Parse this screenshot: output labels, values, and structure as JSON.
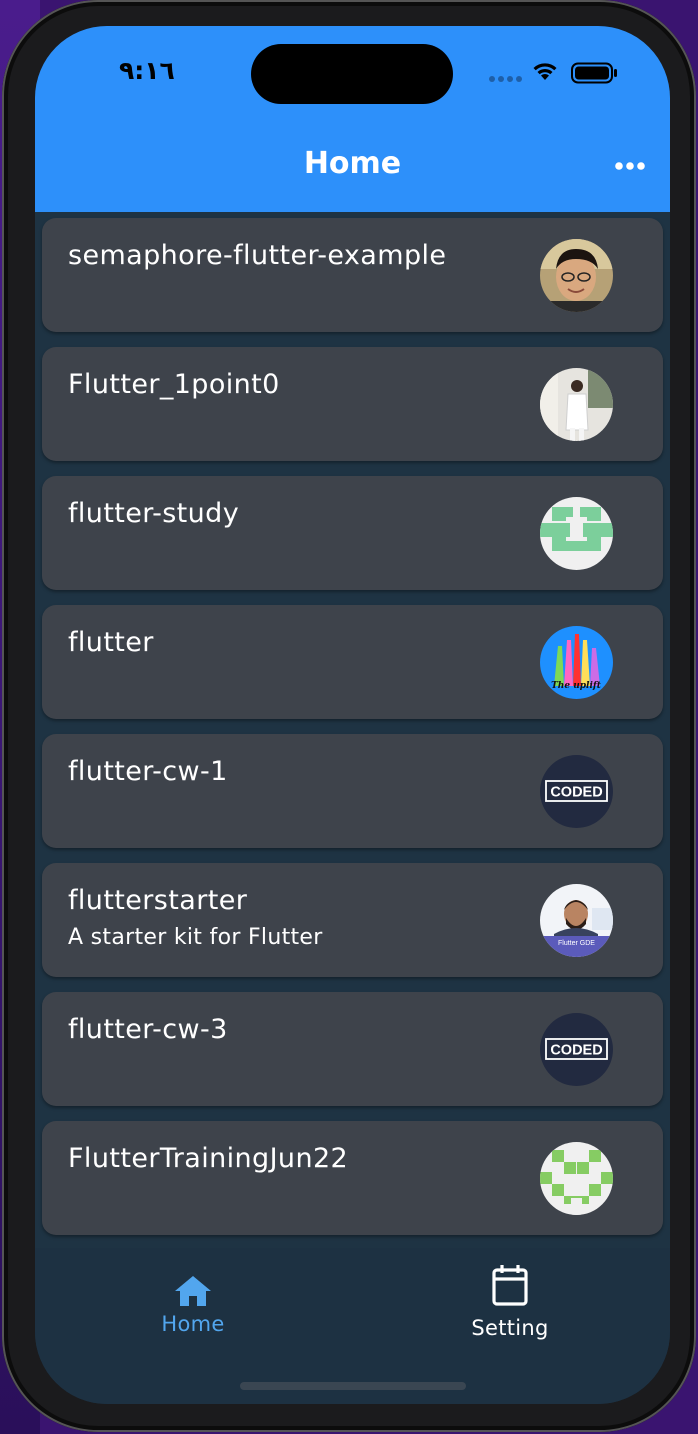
{
  "status_bar": {
    "time": "٩:١٦"
  },
  "appbar": {
    "title": "Home"
  },
  "repos": [
    {
      "title": "semaphore-flutter-example",
      "subtitle": "",
      "avatar": "person-photo"
    },
    {
      "title": "Flutter_1point0",
      "subtitle": "",
      "avatar": "person-photo"
    },
    {
      "title": "flutter-study",
      "subtitle": "",
      "avatar": "identicon-green"
    },
    {
      "title": "flutter",
      "subtitle": "",
      "avatar": "uplift-logo"
    },
    {
      "title": "flutter-cw-1",
      "subtitle": "",
      "avatar": "coded-logo"
    },
    {
      "title": "flutterstarter",
      "subtitle": "A starter kit for Flutter",
      "avatar": "person-photo"
    },
    {
      "title": "flutter-cw-3",
      "subtitle": "",
      "avatar": "coded-logo"
    },
    {
      "title": "FlutterTrainingJun22",
      "subtitle": "",
      "avatar": "identicon-green"
    }
  ],
  "avatar_text": {
    "uplift": "The uplift",
    "coded": "CODED",
    "gde": "Flutter GDE"
  },
  "bottom_nav": {
    "home_label": "Home",
    "setting_label": "Setting",
    "active": "home"
  },
  "colors": {
    "appbar": "#2d90fa",
    "background": "#1e3343",
    "card": "#3e434b",
    "active_nav": "#52a6ee",
    "inactive_nav": "#ffffff"
  }
}
